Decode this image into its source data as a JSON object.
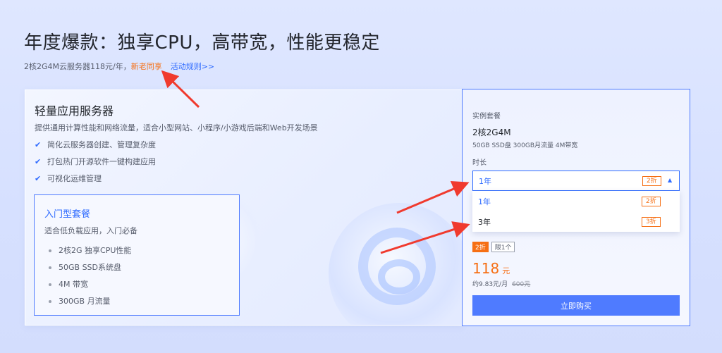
{
  "header": {
    "title": "年度爆款：独享CPU，高带宽，性能更稳定",
    "subtitle": "2核2G4M云服务器118元/年，",
    "tag": "新老同享",
    "rules_link": "活动规则>>"
  },
  "product": {
    "title": "轻量应用服务器",
    "description": "提供通用计算性能和网络流量，适合小型网站、小程序/小游戏后端和Web开发场景",
    "features": [
      "简化云服务器创建、管理复杂度",
      "打包热门开源软件一键构建应用",
      "可视化运维管理"
    ]
  },
  "package": {
    "title": "入门型套餐",
    "subtitle": "适合低负载应用，入门必备",
    "items": [
      "2核2G 独享CPU性能",
      "50GB SSD系统盘",
      "4M 带宽",
      "300GB 月流量"
    ]
  },
  "order": {
    "instance_label": "实例套餐",
    "spec": "2核2G4M",
    "spec_desc": "50GB SSD盘 300GB月流量 4M带宽",
    "duration_label": "时长",
    "selected": {
      "label": "1年",
      "discount": "2折"
    },
    "options": [
      {
        "label": "1年",
        "discount": "2折"
      },
      {
        "label": "3年",
        "discount": "3折"
      }
    ],
    "promo_tag": "2折",
    "limit_tag": "限1个",
    "price": "118",
    "price_unit": "元",
    "per_month": "约9.83元/月",
    "original_price": "600元",
    "buy_label": "立即购买"
  },
  "colors": {
    "accent": "#2f6bff",
    "orange": "#f66f14",
    "arrow": "#f03a2e"
  }
}
